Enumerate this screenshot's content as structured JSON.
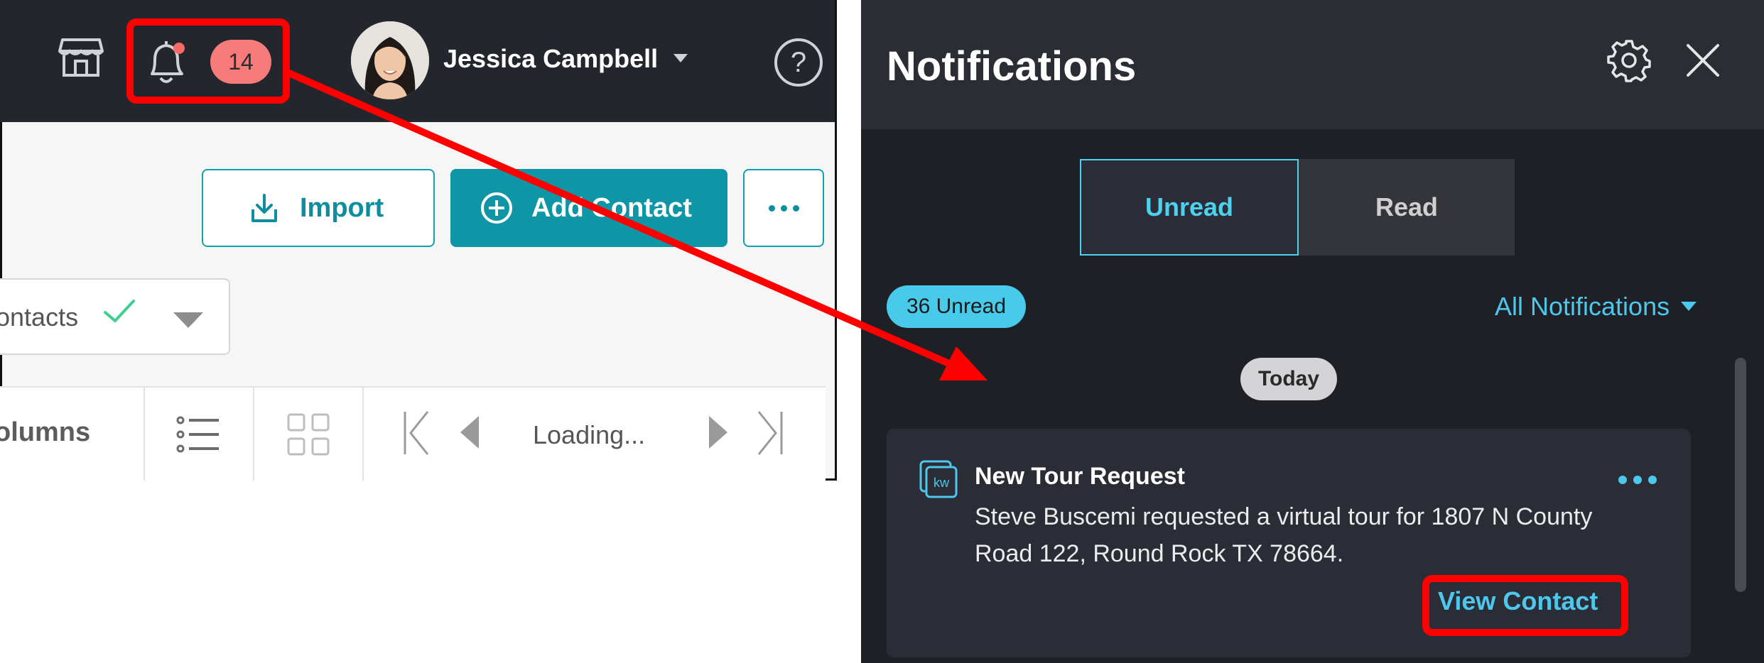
{
  "app": {
    "notification_count": "14",
    "user_name": "Jessica Campbell",
    "help_label": "?"
  },
  "contacts": {
    "import_label": "Import",
    "add_contact_label": "Add Contact",
    "filter_label": "ontacts",
    "columns_label": "olumns",
    "loading_label": "Loading..."
  },
  "notifications": {
    "title": "Notifications",
    "tabs": {
      "unread": "Unread",
      "read": "Read"
    },
    "unread_badge": "36 Unread",
    "filter_label": "All Notifications",
    "date_group": "Today",
    "card": {
      "title": "New Tour Request",
      "body": "Steve Buscemi requested a virtual tour for 1807 N County Road 122, Round Rock TX 78664.",
      "action_label": "View Contact"
    }
  },
  "colors": {
    "accent": "#0f96a6",
    "notif_accent": "#4dc7ec",
    "highlight": "#ff0000",
    "badge": "#f87b7b"
  }
}
